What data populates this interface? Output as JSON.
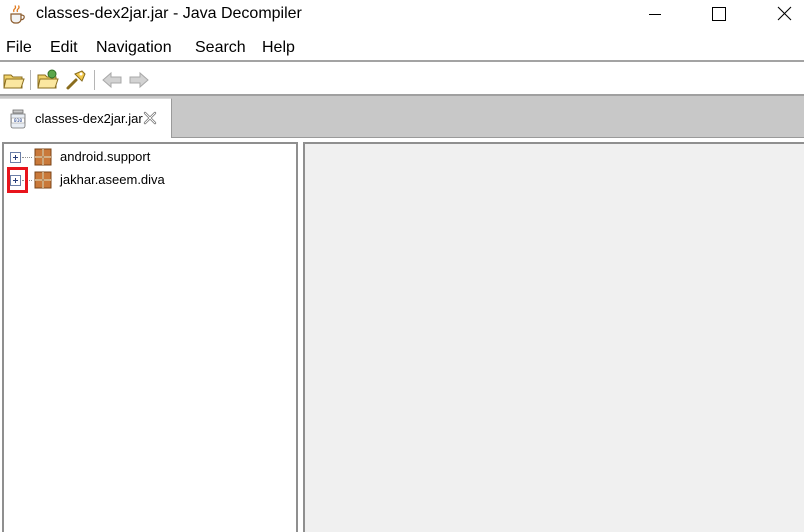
{
  "window": {
    "title": "classes-dex2jar.jar - Java Decompiler",
    "app_icon": "coffee-cup-icon",
    "controls": [
      "minimize-icon",
      "maximize-icon",
      "close-icon"
    ]
  },
  "menubar": {
    "items": [
      {
        "label": "File"
      },
      {
        "label": "Edit"
      },
      {
        "label": "Navigation"
      },
      {
        "label": "Search"
      },
      {
        "label": "Help"
      }
    ]
  },
  "toolbar": {
    "buttons": [
      "open-file-icon",
      "open-type-icon",
      "search-icon",
      "back-arrow-icon",
      "forward-arrow-icon"
    ],
    "back_enabled": false,
    "forward_enabled": false
  },
  "tabs": [
    {
      "label": "classes-dex2jar.jar",
      "icon": "jar-file-icon",
      "active": true
    }
  ],
  "tree": {
    "items": [
      {
        "label": "android.support",
        "icon": "package-icon",
        "expanded": false
      },
      {
        "label": "jakhar.aseem.diva",
        "icon": "package-icon",
        "expanded": false,
        "highlighted": true
      }
    ]
  },
  "colors": {
    "highlight": "#e8141c",
    "tab_strip": "#c8c8c8",
    "content_bg": "#f0f0f0"
  }
}
